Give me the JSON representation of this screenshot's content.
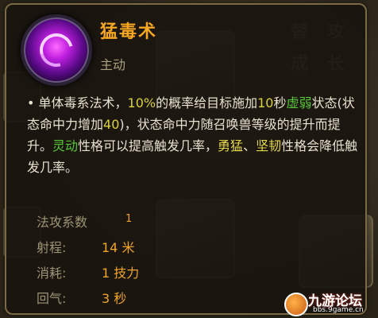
{
  "skill": {
    "name": "猛毒术",
    "type": "主动",
    "icon": "poison-orb-icon"
  },
  "description": {
    "bullet": "•",
    "segments": [
      {
        "text": "单体毒系法术，",
        "style": "normal"
      },
      {
        "text": "10%",
        "style": "num"
      },
      {
        "text": "的概率给目标施加",
        "style": "normal"
      },
      {
        "text": "10",
        "style": "num"
      },
      {
        "text": "秒",
        "style": "normal"
      },
      {
        "text": "虚弱",
        "style": "green"
      },
      {
        "text": "状态(状态命中力增加",
        "style": "normal"
      },
      {
        "text": "40",
        "style": "num"
      },
      {
        "text": ")，状态命中力随召唤兽等级的提升而提升。",
        "style": "normal"
      },
      {
        "text": "灵动",
        "style": "green"
      },
      {
        "text": "性格可以提高触发几率，",
        "style": "normal"
      },
      {
        "text": "勇猛",
        "style": "yellow"
      },
      {
        "text": "、",
        "style": "normal"
      },
      {
        "text": "坚韧",
        "style": "yellow"
      },
      {
        "text": "性格会降低触发几率。",
        "style": "normal"
      }
    ]
  },
  "stats": [
    {
      "label": "法攻系数",
      "value": "1",
      "small": true
    },
    {
      "label": "射程:",
      "value": "14 米",
      "small": false
    },
    {
      "label": "消耗:",
      "value": "1 技力",
      "small": false
    },
    {
      "label": "回气:",
      "value": "3 秒",
      "small": false
    }
  ],
  "background": {
    "chars": [
      "替",
      "攻",
      "成",
      "长"
    ]
  },
  "watermark": {
    "name": "九游论坛",
    "url": "bbs.9game.cn"
  },
  "colors": {
    "title": "#f5a623",
    "number": "#d9d13a",
    "green": "#57c83a",
    "yellow": "#e6d94a",
    "stat_value": "#f0a42a"
  }
}
